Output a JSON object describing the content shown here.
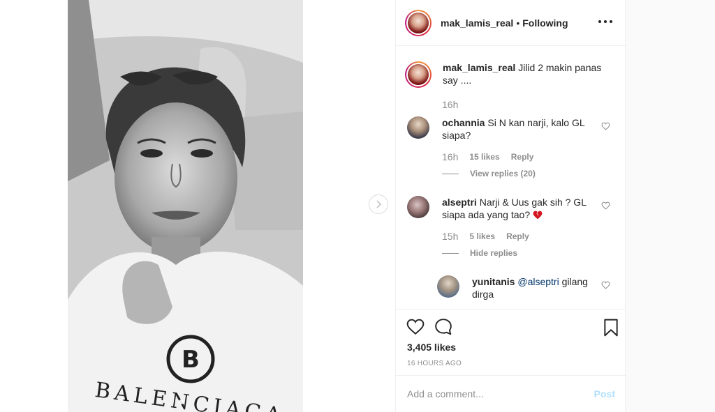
{
  "post": {
    "username": "mak_lamis_real",
    "separator": "•",
    "follow_status": "Following",
    "caption_text": "Jilid 2 makin panas say ....",
    "caption_time": "16h"
  },
  "media": {
    "shirt_text": "BALENCIAGA",
    "shirt_logo": "B"
  },
  "comments": [
    {
      "username": "ochannia",
      "text": "Si N kan narji, kalo GL siapa?",
      "time": "16h",
      "likes": "15 likes",
      "reply_label": "Reply",
      "replies_toggle": "View replies (20)"
    },
    {
      "username": "alseptri",
      "text": "Narji & Uus gak sih ? GL siapa ada yang tao?",
      "time": "15h",
      "likes": "5 likes",
      "reply_label": "Reply",
      "replies_toggle": "Hide replies"
    }
  ],
  "reply": {
    "username": "yunitanis",
    "mention": "@alseptri",
    "text": "gilang dirga"
  },
  "actions": {
    "likes_count": "3,405 likes",
    "timestamp": "16 HOURS AGO"
  },
  "add_comment": {
    "placeholder": "Add a comment...",
    "post_label": "Post"
  },
  "icons": {
    "like": "heart-outline-icon",
    "comment": "speech-bubble-icon",
    "save": "bookmark-icon",
    "more": "more-options-icon",
    "next": "chevron-right-icon",
    "broken_heart_emoji": "broken-heart-emoji"
  },
  "colors": {
    "text": "#262626",
    "muted": "#8e8e8e",
    "mention": "#003569",
    "post_disabled": "#b2dffc",
    "emoji_red": "#d4151f"
  }
}
